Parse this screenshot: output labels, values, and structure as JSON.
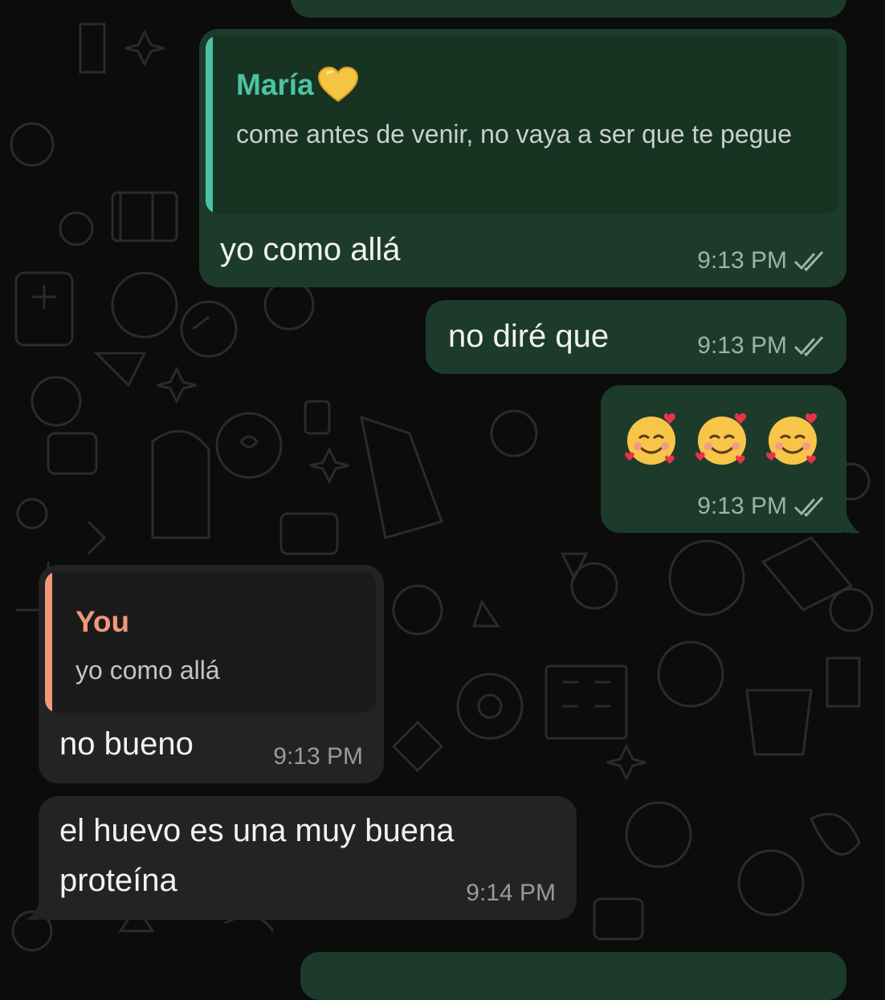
{
  "colors": {
    "background": "#0b0c0b",
    "outgoing_bubble": "#1d3b2b",
    "incoming_bubble": "#232323",
    "quote_maria_accent": "#4cc2a6",
    "quote_you_accent": "#f0997b",
    "heart_emoji": "#f4c542"
  },
  "messages": [
    {
      "direction": "outgoing",
      "quote": {
        "author": "María",
        "author_emoji": "yellow-heart-icon",
        "text": "come antes de venir, no vaya a ser que te pegue"
      },
      "text": "yo como allá",
      "time": "9:13 PM",
      "status": "read"
    },
    {
      "direction": "outgoing",
      "text": "no diré que",
      "time": "9:13 PM",
      "status": "read"
    },
    {
      "direction": "outgoing",
      "emojis": [
        "smiling-face-with-hearts-icon",
        "smiling-face-with-hearts-icon",
        "smiling-face-with-hearts-icon"
      ],
      "time": "9:13 PM",
      "status": "read"
    },
    {
      "direction": "incoming",
      "quote": {
        "author": "You",
        "text": "yo como allá"
      },
      "text": "no bueno",
      "time": "9:13 PM"
    },
    {
      "direction": "incoming",
      "text": "el huevo es una muy buena proteína",
      "time": "9:14 PM"
    }
  ]
}
